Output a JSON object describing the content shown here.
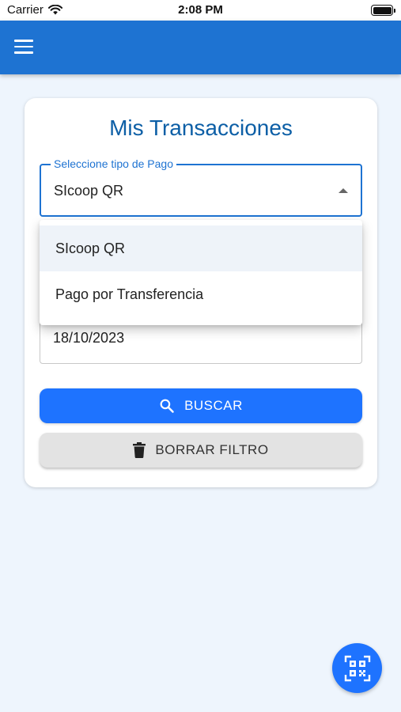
{
  "status_bar": {
    "carrier": "Carrier",
    "time": "2:08 PM"
  },
  "app_bar": {
    "menu_icon": "hamburger-menu-icon",
    "color": "#1e73d2"
  },
  "card": {
    "title": "Mis Transacciones"
  },
  "payment_type_select": {
    "label": "Seleccione tipo de Pago",
    "value": "SIcoop QR",
    "options": [
      "SIcoop QR",
      "Pago por Transferencia"
    ],
    "selected_index": 0
  },
  "date_field": {
    "value": "18/10/2023"
  },
  "buttons": {
    "search_label": "BUSCAR",
    "search_icon": "search-icon",
    "clear_label": "BORRAR FILTRO",
    "clear_icon": "trash-icon"
  },
  "fab": {
    "icon": "qr-scan-icon"
  },
  "colors": {
    "primary": "#1e73d2",
    "accent": "#1e73ff",
    "title": "#0d5fa6",
    "background": "#eef5fd"
  }
}
